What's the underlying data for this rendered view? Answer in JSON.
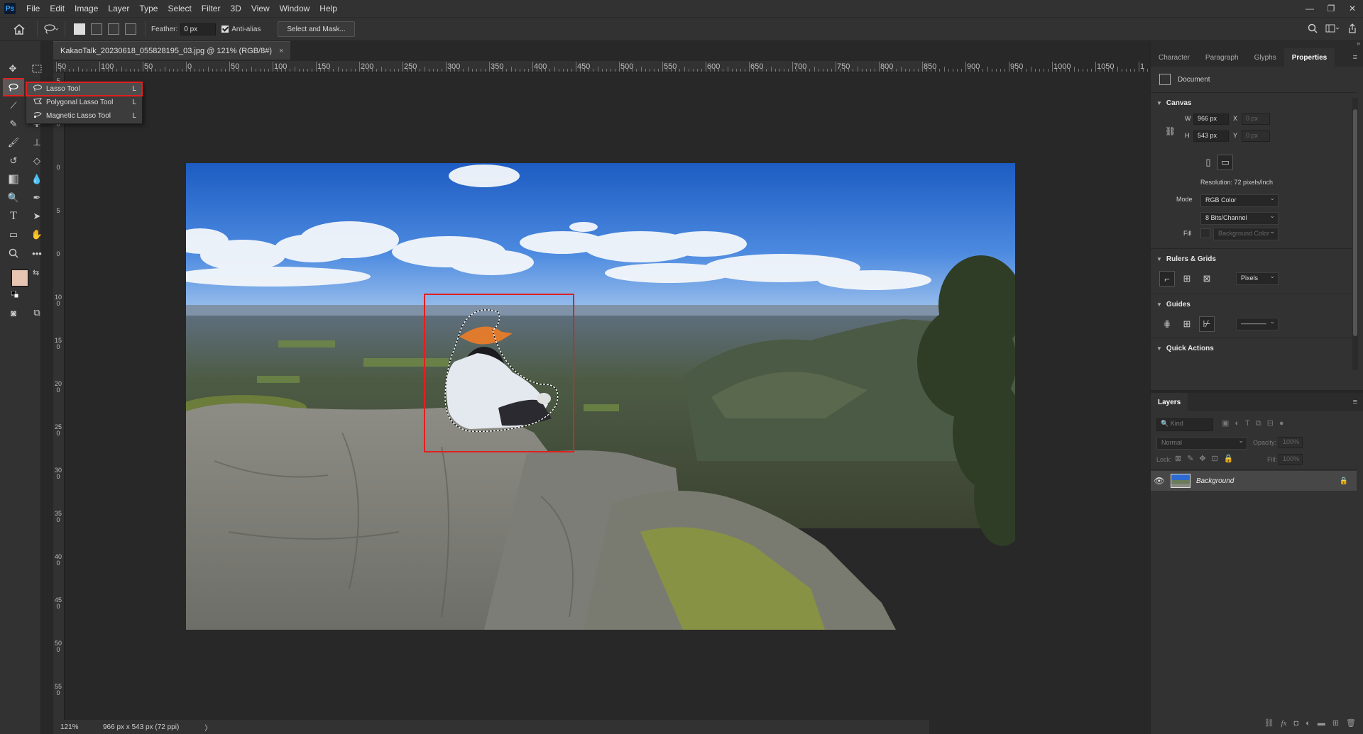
{
  "app": {
    "logo": "Ps"
  },
  "menu": [
    "File",
    "Edit",
    "Image",
    "Layer",
    "Type",
    "Select",
    "Filter",
    "3D",
    "View",
    "Window",
    "Help"
  ],
  "window_controls": {
    "minimize": "—",
    "restore": "❐",
    "close": "✕"
  },
  "options": {
    "feather_label": "Feather:",
    "feather_value": "0 px",
    "anti_alias_label": "Anti-alias",
    "anti_alias_checked": true,
    "select_mask_label": "Select and Mask..."
  },
  "flyout": {
    "items": [
      {
        "label": "Lasso Tool",
        "key": "L",
        "icon": "lasso-icon",
        "selected": true
      },
      {
        "label": "Polygonal Lasso Tool",
        "key": "L",
        "icon": "polygonal-lasso-icon",
        "selected": false
      },
      {
        "label": "Magnetic Lasso Tool",
        "key": "L",
        "icon": "magnetic-lasso-icon",
        "selected": false
      }
    ]
  },
  "document": {
    "tab_title": "KakaoTalk_20230618_055828195_03.jpg @ 121% (RGB/8#)",
    "tab_close": "×"
  },
  "ruler": {
    "h_labels": [
      "50",
      "100",
      "50",
      "0",
      "50",
      "100",
      "150",
      "200",
      "250",
      "300",
      "350",
      "400",
      "450",
      "500",
      "550",
      "600",
      "650",
      "700",
      "750",
      "800",
      "850",
      "900",
      "950",
      "1000",
      "1050",
      "1"
    ],
    "v_labels": [
      "5",
      "0",
      "0",
      "5",
      "0",
      "1\n0\n0",
      "1\n5\n0",
      "2\n0\n0",
      "2\n5\n0",
      "3\n0\n0",
      "3\n5\n0",
      "4\n0\n0",
      "4\n5\n0",
      "5\n0\n0",
      "5\n5\n0",
      "6\n0\n0"
    ]
  },
  "status": {
    "zoom": "121%",
    "info": "966 px x 543 px (72 ppi)",
    "arrow": "〉"
  },
  "panel_tabs": [
    {
      "label": "Character",
      "active": false
    },
    {
      "label": "Paragraph",
      "active": false
    },
    {
      "label": "Glyphs",
      "active": false
    },
    {
      "label": "Properties",
      "active": true
    }
  ],
  "properties": {
    "doc_label": "Document",
    "canvas_title": "Canvas",
    "w_label": "W",
    "w_value": "966 px",
    "h_label": "H",
    "h_value": "543 px",
    "x_label": "X",
    "x_value": "0 px",
    "y_label": "Y",
    "y_value": "0 px",
    "resolution": "Resolution: 72 pixels/inch",
    "mode_label": "Mode",
    "mode_value": "RGB Color",
    "depth_value": "8 Bits/Channel",
    "fill_label": "Fill",
    "fill_value": "Background Color",
    "rulers_title": "Rulers & Grids",
    "units_value": "Pixels",
    "guides_title": "Guides",
    "guides_line": "————",
    "quick_actions_title": "Quick Actions"
  },
  "layers": {
    "title": "Layers",
    "kind_placeholder": "Kind",
    "blend_mode": "Normal",
    "opacity_label": "Opacity:",
    "opacity_value": "100%",
    "lock_label": "Lock:",
    "fill_label": "Fill:",
    "fill_value": "100%",
    "items": [
      {
        "name": "Background",
        "visible": true,
        "locked": true
      }
    ]
  },
  "colors": {
    "foreground": "#e8c4b2",
    "background": "#ffffff",
    "highlight": "#e02020"
  }
}
